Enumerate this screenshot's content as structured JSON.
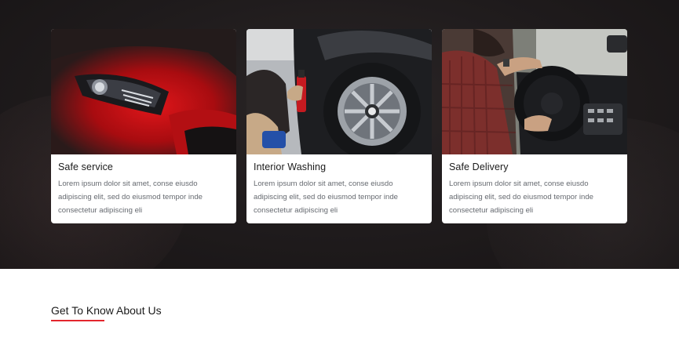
{
  "cards": [
    {
      "title": "Safe service",
      "description": "Lorem ipsum dolor sit amet, conse eiusdo adipiscing elit, sed do eiusmod tempor inde consectetur adipiscing eli",
      "image": "red-car-headlight-image"
    },
    {
      "title": "Interior Washing",
      "description": "Lorem ipsum dolor sit amet, conse eiusdo adipiscing elit, sed do eiusmod tempor inde consectetur adipiscing eli",
      "image": "wheel-cleaning-image"
    },
    {
      "title": "Safe Delivery",
      "description": "Lorem ipsum dolor sit amet, conse eiusdo adipiscing elit, sed do eiusmod tempor inde consectetur adipiscing eli",
      "image": "driver-steering-wheel-image"
    }
  ],
  "about": {
    "heading": "Get To Know About Us",
    "accent_color": "#e3262d"
  },
  "colors": {
    "hero_background": "#1f1b1c",
    "card_background": "#ffffff",
    "text_dark": "#1b1b1b",
    "text_muted": "#666a70"
  }
}
